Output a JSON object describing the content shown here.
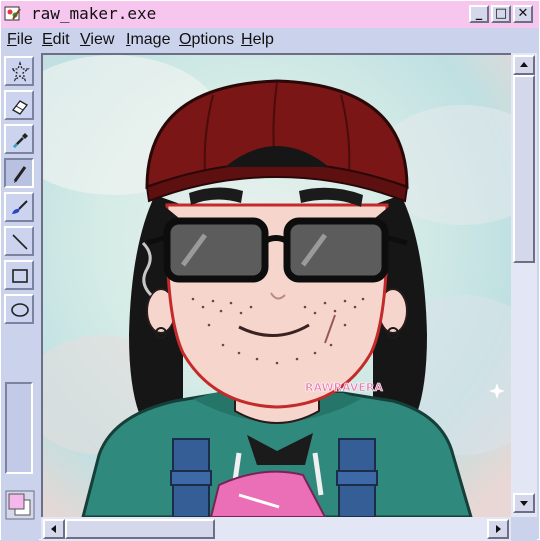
{
  "window": {
    "title": "raw_maker.exe",
    "controls": {
      "minimize": "_",
      "maximize": "□",
      "close": "✕"
    }
  },
  "menu": [
    {
      "label": "File",
      "mnemonic": "F"
    },
    {
      "label": "Edit",
      "mnemonic": "E"
    },
    {
      "label": "View",
      "mnemonic": "V"
    },
    {
      "label": "Image",
      "mnemonic": "I"
    },
    {
      "label": "Options",
      "mnemonic": "O"
    },
    {
      "label": "Help",
      "mnemonic": "H"
    }
  ],
  "tools": [
    {
      "name": "free-form-select-icon",
      "active": false
    },
    {
      "name": "eraser-icon",
      "active": false
    },
    {
      "name": "color-picker-icon",
      "active": false
    },
    {
      "name": "pencil-icon",
      "active": true
    },
    {
      "name": "brush-icon",
      "active": false
    },
    {
      "name": "line-icon",
      "active": false
    },
    {
      "name": "rectangle-icon",
      "active": false
    },
    {
      "name": "ellipse-icon",
      "active": false
    }
  ],
  "colors": {
    "foreground": "#f4b8ec",
    "background": "#ffffff",
    "titlebar": "#f7c6ef",
    "chrome": "#cbd3ec"
  },
  "canvas": {
    "watermark": "RAWRAVERA"
  }
}
